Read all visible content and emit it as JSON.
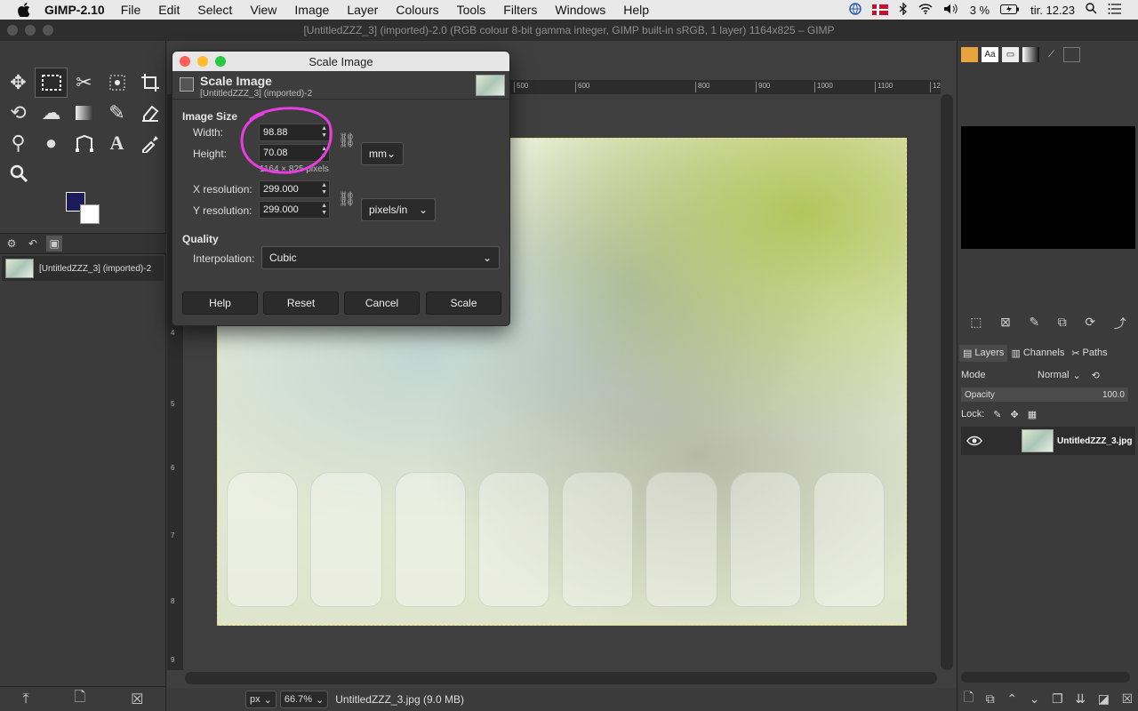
{
  "menubar": {
    "app_name": "GIMP-2.10",
    "items": [
      "File",
      "Edit",
      "Select",
      "View",
      "Image",
      "Layer",
      "Colours",
      "Tools",
      "Filters",
      "Windows",
      "Help"
    ],
    "battery": "3 %",
    "clock": "tir. 12.23"
  },
  "window": {
    "title": "[UntitledZZZ_3] (imported)-2.0 (RGB colour 8-bit gamma integer, GIMP built-in sRGB, 1 layer) 1164x825 – GIMP"
  },
  "toolbox": {
    "fg_color": "#1c1c5c",
    "bg_color": "#ffffff",
    "image_item": "[UntitledZZZ_3] (imported)-2",
    "tools": [
      "move-icon",
      "rect-select-icon",
      "scissors-icon",
      "fuzzy-select-icon",
      "crop-icon",
      "transform-icon",
      "warp-icon",
      "gradient-icon",
      "pencil-icon",
      "eraser-icon",
      "clone-icon",
      "smudge-icon",
      "path-icon",
      "text-icon",
      "color-picker-icon",
      "zoom-icon"
    ]
  },
  "ruler": {
    "h_ticks": [
      "500",
      "600",
      "800",
      "900",
      "1000",
      "1100",
      "12"
    ],
    "v_ticks": [
      "1",
      "2",
      "3",
      "4",
      "5",
      "6",
      "7",
      "8",
      "9"
    ]
  },
  "statusbar": {
    "unit": "px",
    "zoom": "66.7%",
    "file_info": "UntitledZZZ_3.jpg (9.0 MB)"
  },
  "dialog": {
    "window_title": "Scale Image",
    "header_title": "Scale Image",
    "header_subtitle": "[UntitledZZZ_3] (imported)-2",
    "image_size_label": "Image Size",
    "width_label": "Width:",
    "width_value": "98.88",
    "height_label": "Height:",
    "height_value": "70.08",
    "pixels_note": "1164 × 825 pixels",
    "size_unit": "mm",
    "xres_label": "X resolution:",
    "xres_value": "299.000",
    "yres_label": "Y resolution:",
    "yres_value": "299.000",
    "res_unit": "pixels/in",
    "quality_label": "Quality",
    "interp_label": "Interpolation:",
    "interp_value": "Cubic",
    "buttons": {
      "help": "Help",
      "reset": "Reset",
      "cancel": "Cancel",
      "scale": "Scale"
    }
  },
  "layers": {
    "tabs": [
      "Layers",
      "Channels",
      "Paths"
    ],
    "mode_label": "Mode",
    "mode_value": "Normal",
    "opacity_label": "Opacity",
    "opacity_value": "100.0",
    "lock_label": "Lock:",
    "layer_name": "UntitledZZZ_3.jpg"
  },
  "colors": {
    "annotation": "#e83de0"
  }
}
